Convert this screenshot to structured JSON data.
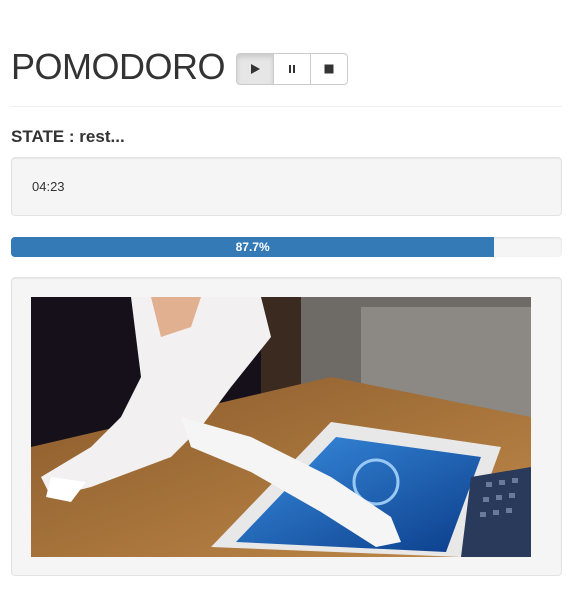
{
  "title": "POMODORO",
  "controls": {
    "play_icon": "play-icon",
    "pause_icon": "pause-icon",
    "stop_icon": "stop-icon"
  },
  "state": {
    "label": "STATE : rest..."
  },
  "timer": {
    "value": "04:23"
  },
  "progress": {
    "percent": 87.7,
    "label": "87.7%",
    "color": "#337ab7"
  },
  "media": {
    "icon": "cat-gif-image"
  }
}
